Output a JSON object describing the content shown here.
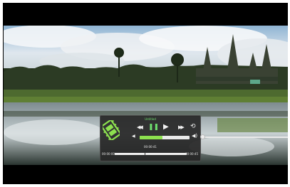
{
  "player": {
    "title": "Untitled",
    "current_time": "00:00:41",
    "elapsed": "00:00:00",
    "duration": "00:00:45",
    "volume_fraction": 0.45,
    "playback_fraction": 0.42
  },
  "icons": {
    "logo": "film-strip-icon",
    "previous": "rewind-icon",
    "pause": "pause-icon",
    "play": "play-icon",
    "next": "fast-forward-icon",
    "repeat": "repeat-icon",
    "volume_down": "volume-low-icon",
    "volume_up": "volume-high-icon"
  },
  "colors": {
    "accent": "#8de14f",
    "panel": "#262626",
    "letterbox": "#000000"
  }
}
